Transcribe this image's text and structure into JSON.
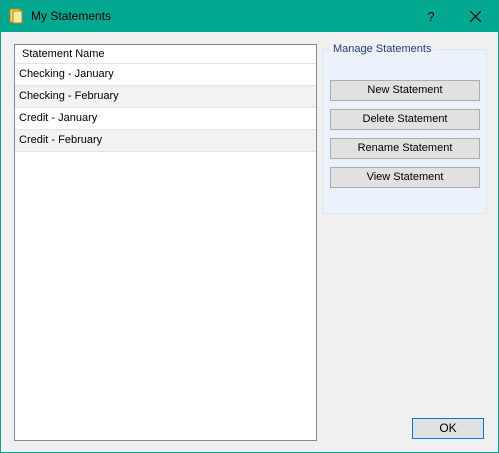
{
  "window": {
    "title": "My Statements",
    "help_glyph": "?",
    "accent": "#00a88f"
  },
  "list": {
    "header": "Statement Name",
    "rows": [
      "Checking - January",
      "Checking - February",
      "Credit - January",
      "Credit - February"
    ]
  },
  "manage": {
    "legend": "Manage Statements",
    "new_label": "New Statement",
    "delete_label": "Delete Statement",
    "rename_label": "Rename Statement",
    "view_label": "View Statement"
  },
  "footer": {
    "ok_label": "OK"
  },
  "icons": {
    "title": "notebook-icon",
    "close": "close-icon"
  }
}
